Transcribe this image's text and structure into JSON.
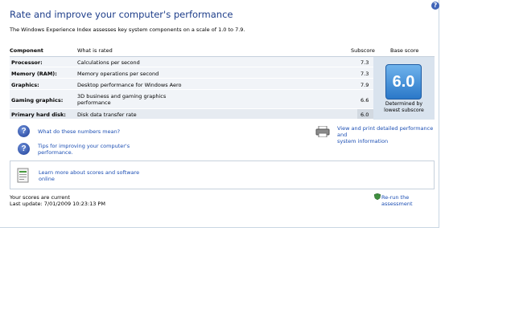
{
  "window": {
    "title": "Rate and improve your computer's performance",
    "description": "The Windows Experience Index assesses key system components on a scale of 1.0 to 7.9."
  },
  "table": {
    "headers": {
      "component": "Component",
      "what_is_rated": "What is rated",
      "subscore": "Subscore",
      "base_score": "Base score"
    },
    "rows": [
      {
        "component": "Processor:",
        "rated": "Calculations per second",
        "subscore": "7.3"
      },
      {
        "component": "Memory (RAM):",
        "rated": "Memory operations per second",
        "subscore": "7.3"
      },
      {
        "component": "Graphics:",
        "rated": "Desktop performance for Windows Aero",
        "subscore": "7.9"
      },
      {
        "component": "Gaming graphics:",
        "rated": "3D business and gaming graphics",
        "rated2": "performance",
        "subscore": "6.6"
      },
      {
        "component": "Primary hard disk:",
        "rated": "Disk data transfer rate",
        "subscore": "6.0"
      }
    ],
    "base_score": "6.0",
    "base_caption_1": "Determined by",
    "base_caption_2": "lowest subscore"
  },
  "links": {
    "what_numbers_mean": "What do these numbers mean?",
    "tips_1": "Tips for improving your computer's",
    "tips_2": "performance.",
    "print_1": "View and print detailed performance and",
    "print_2": "system information",
    "learn_1": "Learn more about scores and software",
    "learn_2": "online",
    "rerun": "Re-run the assessment"
  },
  "status": {
    "current": "Your scores are current",
    "last_update": "Last update: 7/01/2009 10:23:13 PM"
  },
  "colors": {
    "title": "#1e3e8a",
    "link": "#1a4db3",
    "badge": "#2b78c8"
  }
}
